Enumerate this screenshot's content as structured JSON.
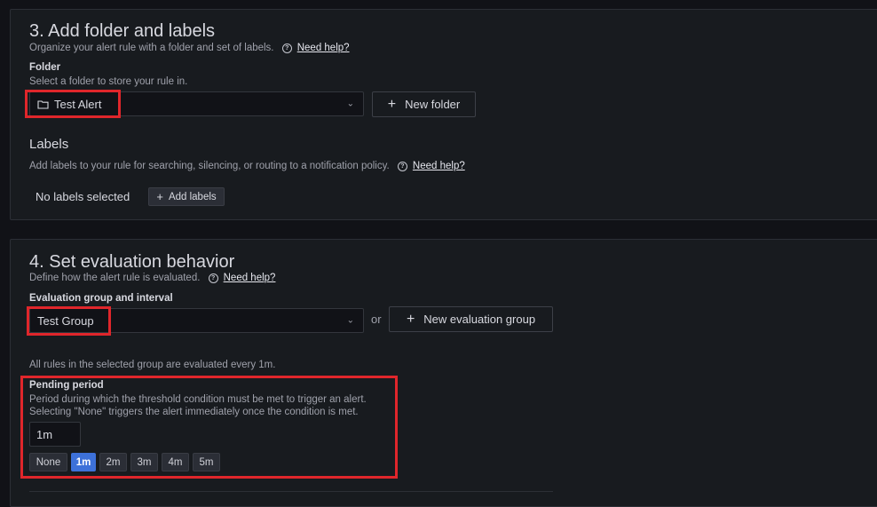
{
  "section3": {
    "title": "3. Add folder and labels",
    "description": "Organize your alert rule with a folder and set of labels.",
    "help_link": "Need help?",
    "folder": {
      "label": "Folder",
      "description": "Select a folder to store your rule in.",
      "selected": "Test Alert",
      "new_button": "New folder"
    },
    "labels": {
      "title": "Labels",
      "description": "Add labels to your rule for searching, silencing, or routing to a notification policy.",
      "help_link": "Need help?",
      "empty_text": "No labels selected",
      "add_button": "Add labels"
    }
  },
  "section4": {
    "title": "4. Set evaluation behavior",
    "description": "Define how the alert rule is evaluated.",
    "help_link": "Need help?",
    "group": {
      "label": "Evaluation group and interval",
      "selected": "Test Group",
      "or_text": "or",
      "new_button": "New evaluation group",
      "interval_note": "All rules in the selected group are evaluated every 1m."
    },
    "pending": {
      "label": "Pending period",
      "description_line1": "Period during which the threshold condition must be met to trigger an alert.",
      "description_line2": "Selecting \"None\" triggers the alert immediately once the condition is met.",
      "value": "1m",
      "options": [
        "None",
        "1m",
        "2m",
        "3m",
        "4m",
        "5m"
      ],
      "selected": "1m"
    }
  },
  "colors": {
    "accent": "#3d71d9",
    "highlight": "#e0262b",
    "background": "#111217",
    "panel": "#181b1f"
  }
}
